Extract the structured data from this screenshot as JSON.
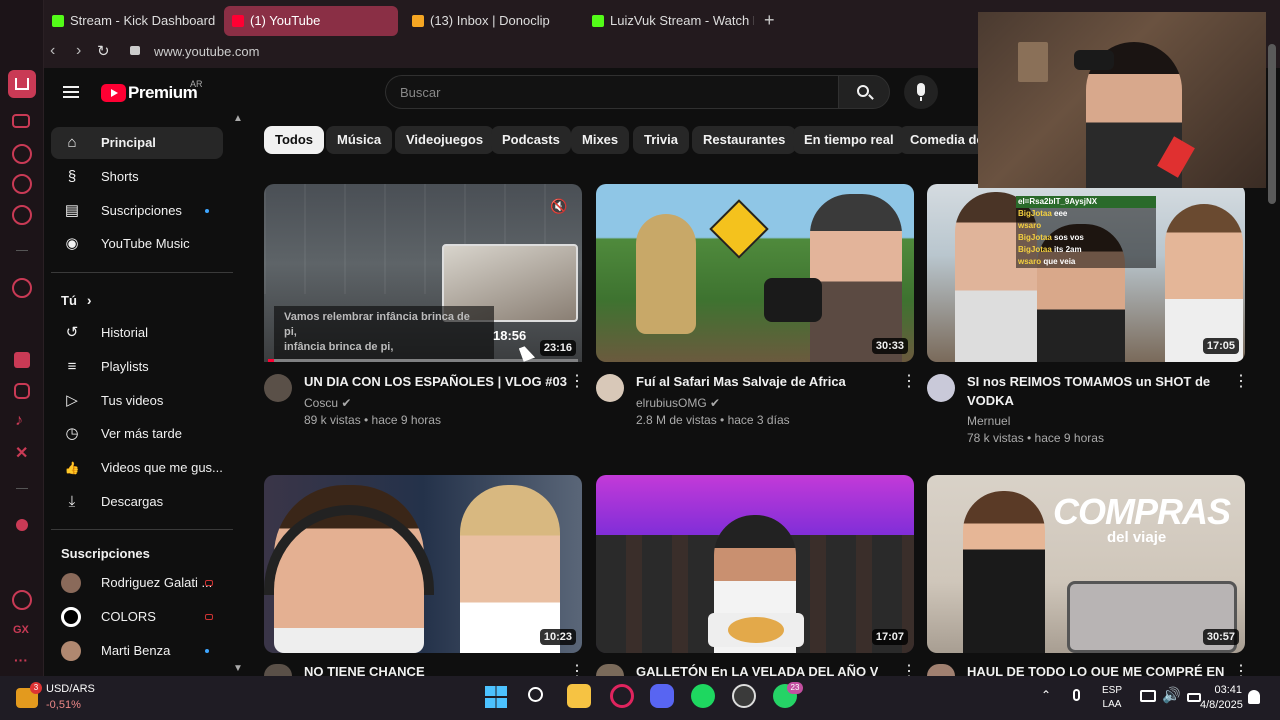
{
  "browser": {
    "tabs": [
      {
        "label": "Stream - Kick Dashboard",
        "color": "#53fc18"
      },
      {
        "label": "(1) YouTube",
        "color": "#ff0033"
      },
      {
        "label": "(13) Inbox | Donoclip",
        "color": "#f5a623"
      },
      {
        "label": "LuizVuk Stream - Watch L",
        "color": "#53fc18"
      }
    ],
    "url": "www.youtube.com",
    "new_tab_symbol": "+"
  },
  "youtube": {
    "logo_text": "Premium",
    "region": "AR",
    "search_placeholder": "Buscar",
    "nav_main": [
      {
        "label": "Principal",
        "icon": "home-icon",
        "glyph": "⌂"
      },
      {
        "label": "Shorts",
        "icon": "shorts-icon",
        "glyph": "§"
      },
      {
        "label": "Suscripciones",
        "icon": "subscriptions-icon",
        "glyph": "▤"
      },
      {
        "label": "YouTube Music",
        "icon": "music-icon",
        "glyph": "◉"
      }
    ],
    "you_label": "Tú",
    "nav_you": [
      {
        "label": "Historial",
        "icon": "history-icon",
        "glyph": "↺"
      },
      {
        "label": "Playlists",
        "icon": "playlists-icon",
        "glyph": "≡"
      },
      {
        "label": "Tus videos",
        "icon": "your-videos-icon",
        "glyph": "▷"
      },
      {
        "label": "Ver más tarde",
        "icon": "watch-later-icon",
        "glyph": "◷"
      },
      {
        "label": "Videos que me gus...",
        "icon": "like-icon",
        "glyph": "👍"
      },
      {
        "label": "Descargas",
        "icon": "download-icon",
        "glyph": "⤓"
      }
    ],
    "subs_heading": "Suscripciones",
    "subscriptions": [
      {
        "label": "Rodriguez Galati ...",
        "color": "#8a6a5a"
      },
      {
        "label": "COLORS",
        "color": "#ffffff"
      },
      {
        "label": "Marti Benza",
        "color": "#b08870"
      }
    ],
    "chips": [
      "Todos",
      "Música",
      "Videojuegos",
      "Podcasts",
      "Mixes",
      "Trivia",
      "Restaurantes",
      "En tiempo real",
      "Comedia de s"
    ],
    "videos": [
      {
        "title_line1": "UN DIA CON LOS ESPAÑOLES | VLOG #03",
        "title_line2": "",
        "channel": "Coscu",
        "meta": "89 k vistas • hace 9 horas",
        "duration": "23:16",
        "verified": true
      },
      {
        "title_line1": "Fuí al Safari Mas Salvaje de Africa",
        "title_line2": "",
        "channel": "elrubiusOMG",
        "meta": "2.8 M de vistas • hace 3 días",
        "duration": "30:33",
        "verified": true
      },
      {
        "title_line1": "SI nos REIMOS TOMAMOS un SHOT de",
        "title_line2": "VODKA",
        "channel": "Mernuel",
        "meta": "78 k vistas • hace 9 horas",
        "duration": "17:05",
        "verified": false
      },
      {
        "title_line1": "NO TIENE CHANCE",
        "duration": "10:23"
      },
      {
        "title_line1": "GALLETÓN En LA VELADA DEL AÑO V",
        "duration": "17:07"
      },
      {
        "title_line1": "HAUL DE TODO LO QUE ME COMPRÉ EN",
        "duration": "30:57"
      }
    ],
    "preview": {
      "caption_line1": "Vamos relembrar infância brinca de pi,",
      "caption_line2": "infância brinca de pi,",
      "hover_time": "18:56",
      "progress": 0.02
    },
    "thumb6_overlay": {
      "line1": "COMPRAS",
      "line2": "del viaje"
    }
  },
  "overlay": {
    "chat": [
      {
        "user": "el=Rsa2blT_9AysjNX",
        "msg": ""
      },
      {
        "user": "BigJotaa",
        "msg": "eee"
      },
      {
        "user": "wsaro",
        "msg": ""
      },
      {
        "user": "BigJotaa",
        "msg": "sos vos"
      },
      {
        "user": "BigJotaa",
        "msg": "its 2am"
      },
      {
        "user": "wsaro",
        "msg": "que veia"
      }
    ]
  },
  "taskbar": {
    "weather_label": "USD/ARS",
    "weather_value": "-0,51%",
    "weather_badge": "3",
    "lang1": "ESP",
    "lang2": "LAA",
    "time": "03:41",
    "date": "4/8/2025",
    "whatsapp_badge": "23"
  },
  "colors": {
    "yt_red": "#ff0033",
    "opera_red": "#c93a55",
    "background": "#0f0f0f"
  }
}
